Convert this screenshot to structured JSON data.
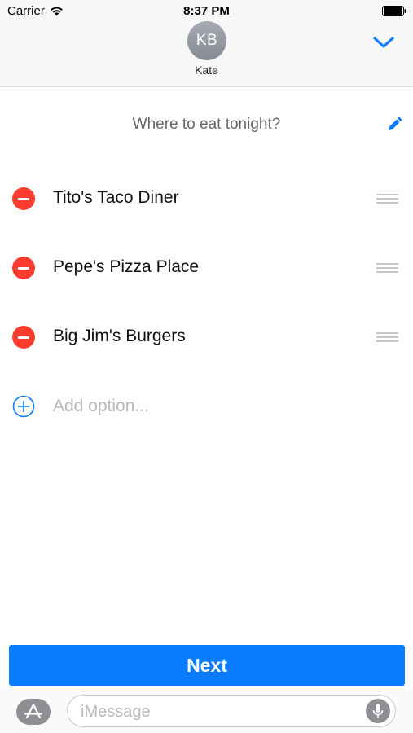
{
  "status_bar": {
    "carrier": "Carrier",
    "time": "8:37 PM"
  },
  "header": {
    "avatar_initials": "KB",
    "contact_name": "Kate"
  },
  "poll": {
    "question": "Where to eat tonight?",
    "options": [
      {
        "label": "Tito's Taco Diner"
      },
      {
        "label": "Pepe's Pizza Place"
      },
      {
        "label": "Big Jim's Burgers"
      }
    ],
    "add_option_placeholder": "Add option..."
  },
  "next_button_label": "Next",
  "compose": {
    "placeholder": "iMessage"
  },
  "icons": {
    "wifi": "wifi-icon",
    "battery": "battery-icon",
    "collapse": "chevron-down-icon",
    "edit": "pencil-icon",
    "remove": "minus-circle-icon",
    "reorder": "drag-handle-icon",
    "add": "plus-circle-icon",
    "apps": "app-store-icon",
    "mic": "microphone-icon"
  },
  "colors": {
    "accent": "#0a7cff",
    "remove": "#fd3c30",
    "header_bg": "#f7f7f7",
    "avatar_bg": "#969ba4"
  }
}
